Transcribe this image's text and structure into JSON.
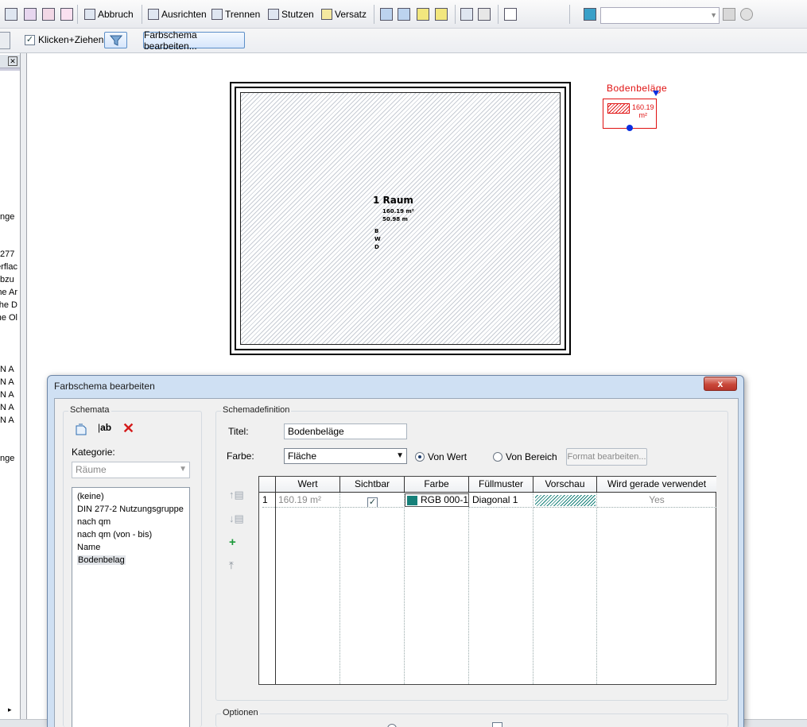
{
  "toolbar": {
    "abbruch": "Abbruch",
    "ausrichten": "Ausrichten",
    "trennen": "Trennen",
    "stutzen": "Stutzen",
    "versatz": "Versatz",
    "combo_value": ""
  },
  "toolbar2": {
    "klicken_ziehen": "Klicken+Ziehen",
    "farbschema_button": "Farbschema bearbeiten..."
  },
  "left_panel": {
    "snippets": [
      "nge",
      "277",
      "erflac",
      "bzu",
      "he Ar",
      "he D",
      "he Ol",
      "N A",
      "N A",
      "N A",
      "N A",
      "N A",
      "nge"
    ]
  },
  "drawing": {
    "room_name": "1 Raum",
    "room_area": "160.19 m²",
    "room_perimeter": "50.98 m",
    "room_codes": [
      "B",
      "W",
      "D"
    ],
    "legend_title": "Bodenbeläge",
    "legend_value": "160.19",
    "legend_unit": "m²",
    "accent": "#e01010"
  },
  "dialog": {
    "title": "Farbschema bearbeiten",
    "close_label": "x",
    "schemata": {
      "group_label": "Schemata",
      "rename_label": "ab",
      "kategorie_label": "Kategorie:",
      "kategorie_value": "Räume",
      "items": [
        "(keine)",
        "DIN 277-2 Nutzungsgruppe",
        "nach qm",
        "nach qm (von - bis)",
        "Name",
        "Bodenbelag"
      ],
      "selected": "Bodenbelag"
    },
    "schemadefinition": {
      "group_label": "Schemadefinition",
      "titel_label": "Titel:",
      "titel_value": "Bodenbeläge",
      "farbe_label": "Farbe:",
      "farbe_value": "Fläche",
      "von_wert": "Von Wert",
      "von_bereich": "Von Bereich",
      "format_button": "Format bearbeiten...",
      "grid": {
        "columns": [
          "Wert",
          "Sichtbar",
          "Farbe",
          "Füllmuster",
          "Vorschau",
          "Wird gerade verwendet"
        ],
        "rows": [
          {
            "index": "1",
            "wert": "160.19 m²",
            "sichtbar": "✓",
            "farbe": "RGB 000-1",
            "swatch": "#168079",
            "fuellmuster": "Diagonal 1",
            "verwendet": "Yes"
          }
        ]
      }
    },
    "optionen": {
      "group_label": "Optionen"
    }
  }
}
